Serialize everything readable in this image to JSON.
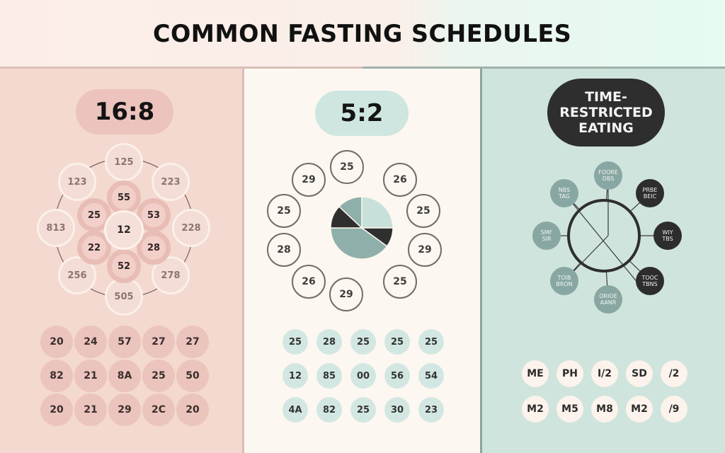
{
  "title": "COMMON FASTING SCHEDULES",
  "colors": {
    "panel_16_8": "#f4d9d0",
    "panel_5_2": "#fdf7f1",
    "panel_tre": "#cfe4dd",
    "pie_light": "#c8e0da",
    "pie_mid": "#8fb0aa",
    "pie_dark": "#2f2f2f"
  },
  "panels": [
    {
      "id": "16-8",
      "heading": "16:8",
      "outer_ring": [
        "125",
        "223",
        "228",
        "278",
        "505",
        "256",
        "813",
        "123"
      ],
      "inner_ring": [
        "55",
        "53",
        "28",
        "52",
        "22",
        "25"
      ],
      "center": "12",
      "grid": [
        [
          "20",
          "24",
          "57",
          "27",
          "27"
        ],
        [
          "82",
          "21",
          "8A",
          "25",
          "50"
        ],
        [
          "20",
          "21",
          "29",
          "2C",
          "20"
        ]
      ]
    },
    {
      "id": "5-2",
      "heading": "5:2",
      "ring": [
        "25",
        "26",
        "25",
        "29",
        "25",
        "29",
        "26",
        "28",
        "25",
        "29"
      ],
      "pie": [
        {
          "label": "light",
          "fraction": 0.25
        },
        {
          "label": "dark-right",
          "fraction": 0.1
        },
        {
          "label": "mid-bottom",
          "fraction": 0.4
        },
        {
          "label": "dark-left",
          "fraction": 0.12
        },
        {
          "label": "mid-top",
          "fraction": 0.13
        }
      ],
      "grid": [
        [
          "25",
          "28",
          "25",
          "25",
          "25"
        ],
        [
          "12",
          "85",
          "00",
          "56",
          "54"
        ],
        [
          "4A",
          "82",
          "25",
          "30",
          "23"
        ]
      ]
    },
    {
      "id": "tre",
      "heading": "TIME-\nRESTRICTED\nEATING",
      "nodes": [
        {
          "text": "FOORE\nDBS",
          "tone": "light"
        },
        {
          "text": "PRBE\nBEIC",
          "tone": "dark"
        },
        {
          "text": "WIY\nTBS",
          "tone": "dark"
        },
        {
          "text": "TOOC\nTBNS",
          "tone": "dark"
        },
        {
          "text": "ORIOE\nAANR",
          "tone": "light"
        },
        {
          "text": "TOIB\nBRON",
          "tone": "light"
        },
        {
          "text": "SMF\nSIR",
          "tone": "light"
        },
        {
          "text": "NBS\nTAG",
          "tone": "light"
        }
      ],
      "grid": [
        [
          "ME",
          "PH",
          "I/2",
          "SD",
          "/2"
        ],
        [
          "M2",
          "M5",
          "M8",
          "M2",
          "/9"
        ]
      ]
    }
  ]
}
